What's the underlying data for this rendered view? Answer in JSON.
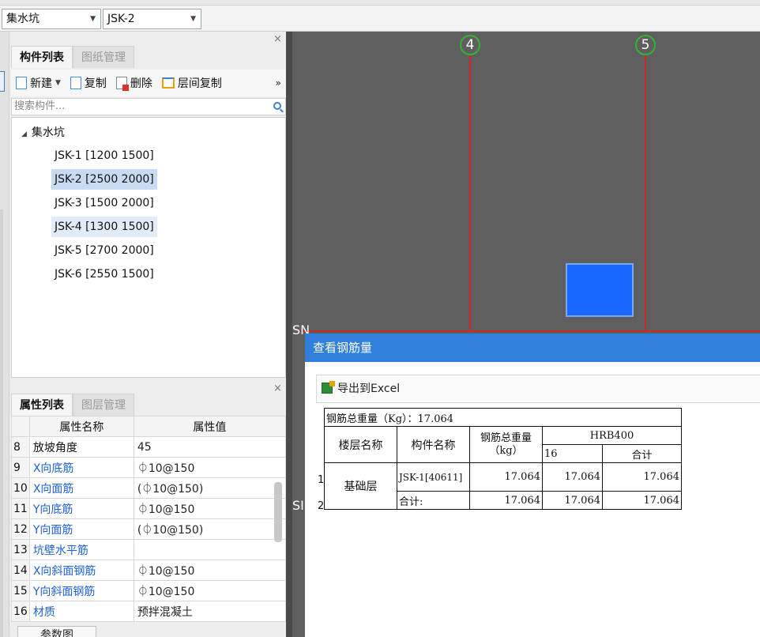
{
  "top": {
    "type_combo": "集水坑",
    "item_combo": "JSK-2"
  },
  "component_panel": {
    "tabs": [
      "构件列表",
      "图纸管理"
    ],
    "toolbar": {
      "new": "新建",
      "copy": "复制",
      "delete": "删除",
      "floor_copy": "层间复制"
    },
    "search_placeholder": "搜索构件...",
    "tree_root": "集水坑",
    "items": [
      "JSK-1 [1200 1500]",
      "JSK-2 [2500 2000]",
      "JSK-3 [1500 2000]",
      "JSK-4 [1300 1500]",
      "JSK-5 [2700 2000]",
      "JSK-6 [2550 1500]"
    ],
    "selected": "JSK-2 [2500 2000]"
  },
  "property_panel": {
    "tabs": [
      "属性列表",
      "图层管理"
    ],
    "col_name": "属性名称",
    "col_value": "属性值",
    "rows": [
      {
        "idx": "8",
        "name": "放坡角度",
        "value": "45",
        "color": "black"
      },
      {
        "idx": "9",
        "name": "X向底筋",
        "value": "⏀10@150",
        "color": "blue"
      },
      {
        "idx": "10",
        "name": "X向面筋",
        "value": "(⏀10@150)",
        "color": "blue"
      },
      {
        "idx": "11",
        "name": "Y向底筋",
        "value": "⏀10@150",
        "color": "blue"
      },
      {
        "idx": "12",
        "name": "Y向面筋",
        "value": "(⏀10@150)",
        "color": "blue"
      },
      {
        "idx": "13",
        "name": "坑壁水平筋",
        "value": "",
        "color": "blue"
      },
      {
        "idx": "14",
        "name": "X向斜面钢筋",
        "value": "⏀10@150",
        "color": "blue"
      },
      {
        "idx": "15",
        "name": "Y向斜面钢筋",
        "value": "⏀10@150",
        "color": "blue"
      },
      {
        "idx": "16",
        "name": "材质",
        "value": "预拌混凝土",
        "color": "blue"
      }
    ],
    "bottom_button": "参数图"
  },
  "canvas": {
    "axis_labels": [
      "4",
      "5"
    ],
    "marker_a": "SN",
    "marker_b": "SI"
  },
  "dialog": {
    "title": "查看钢筋量",
    "export_label": "导出到Excel",
    "total_label": "钢筋总重量（Kg）：17.064",
    "headers": {
      "floor": "楼层名称",
      "component": "构件名称",
      "total_weight": "钢筋总重量（kg）",
      "grade": "HRB400",
      "dia": "16",
      "subtotal": "合计"
    },
    "rows": [
      {
        "num": "1",
        "floor": "基础层",
        "component": "JSK-1[40611]",
        "total": "17.064",
        "dia": "17.064",
        "subtotal": "17.064"
      },
      {
        "num": "2",
        "component": "合计:",
        "total": "17.064",
        "dia": "17.064",
        "subtotal": "17.064"
      }
    ]
  },
  "colors": {
    "dialog_title_bar": "#2f7fdb",
    "pit_fill": "#1868ff",
    "axis_line": "#c82a2a",
    "axis_circle": "#30b530"
  }
}
